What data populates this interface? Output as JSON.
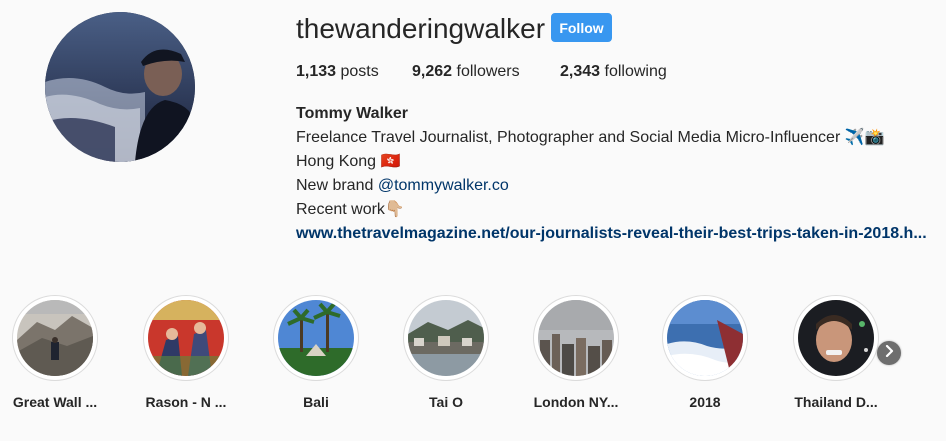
{
  "profile": {
    "username": "thewanderingwalker",
    "follow_label": "Follow",
    "stats": {
      "posts_count": "1,133",
      "posts_label": "posts",
      "followers_count": "9,262",
      "followers_label": "followers",
      "following_count": "2,343",
      "following_label": "following"
    },
    "bio": {
      "full_name": "Tommy Walker",
      "line1": "Freelance Travel Journalist, Photographer and Social Media Micro-Influencer ✈️📸",
      "line2": "Hong Kong 🇭🇰",
      "line3_prefix": "New brand ",
      "line3_mention": "@tommywalker.co",
      "line4": "Recent work👇🏼",
      "link": "www.thetravelmagazine.net/our-journalists-reveal-their-best-trips-taken-in-2018.h..."
    }
  },
  "highlights": [
    {
      "label": "Great Wall ..."
    },
    {
      "label": "Rason - N ..."
    },
    {
      "label": "Bali"
    },
    {
      "label": "Tai O"
    },
    {
      "label": "London NY..."
    },
    {
      "label": "2018"
    },
    {
      "label": "Thailand D..."
    }
  ],
  "colors": {
    "accent": "#3897f0",
    "link": "#003569",
    "text": "#262626",
    "background": "#fafafa"
  },
  "icons": {
    "next": "chevron-right-icon"
  }
}
